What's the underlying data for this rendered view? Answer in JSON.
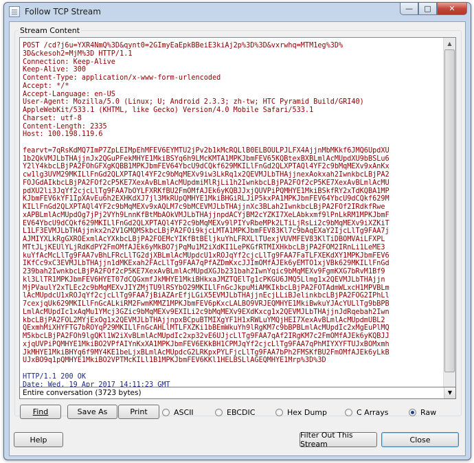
{
  "window": {
    "title": "Follow TCP Stream",
    "caption_buttons": [
      "minimize-icon",
      "maximize-icon",
      "close-icon"
    ]
  },
  "group": {
    "label": "Stream Content"
  },
  "stream": {
    "request_lines": [
      "POST /cd?j6u=YXR4NmQ%3D&qynt0=2GImyEaEpkBBeiE3kiAj2p%3D%3D&vxrwhq=MTM1eg%3D%",
      "3D&ckesoh2=MjM%3D HTTP/1.1",
      "Connection: Keep-Alive",
      "Keep-Alive: 300",
      "Content-Type: application/x-www-form-urlencoded",
      "Accept: */*",
      "Accept-Language: en-US",
      "User-Agent: Mozilla/5.0 (Linux; U; Android 2.3.3; zh-tw; HTC Pyramid Build/GRI40)",
      "AppleWebKit/533.1 (KHTML, like Gecko) Version/4.0 Mobile Safari/533.1",
      "Charset: utf-8",
      "Content-Length: 2335",
      "Host: 100.198.119.6"
    ],
    "body_lines": [
      "fearvt=7qRsKdMQ7ImP7ZpLEIMpEhMFEV6EYMTU2jPv2b1kMcRQLlB0ELBOULPJLFX4AjjnMbMKkf6JMQ6UpdXU",
      "1b2QkVMJLbTHAjjnJx2QGuPFekMHYE1MkiBSYq6h9LMcKMTA1MPKJbmFEV65KQBtexBXBLmlAcMUpdXU9bBSLu6",
      "Y2lY4kbcLBjPA2FOhGFXgKQBB1MPKJbmFEV64YbcU9dCQkf629MKILlFnGd2QLXPTAQl4YF2c9bMqMEXv9xAnKx",
      "cw1lg3UVM29MKILlFnGd2QLXPTAQl4YF2c9bMqMEXv9iw3LkRq1x2QEVMJLbTHAjjnexAokxah2IwnkbcLBjPA2",
      "FOJGdAIkbcLBjPA2FOf2cP5KE7XexAvBLmlAcMUpdmiMlRjLi1h2IwnkbcLBjPA2FOf2cP5KE7XexAvBLmlAcMU",
      "pdXU2li3JqYf2cjcLlTg9FAA7bOYLFXRKfBU2FmOMfAJEk6yKQBJJxjQUVPiPQMHYE1MkiBSkfRY2xTdKQBA1MP",
      "KJbmFEV6kYF1IpXAvEu6h2EXHKdXJ7jl3MkRUpQMHYE1MkiBHGiRLJiP5kxPA1MPKJbmFEV64YbcU9dCQkf629M",
      "KILlFnGd2QLXPTAQl4YF2c9bMqMEXv9xAQLM7c9bMCEVMJLbTHAjjnXc3BLah2IwnkbcLBjPA2FOf2IRdkfRwe",
      "xAPBLmlAcMUpdOg7jPj2VYh9LnnKfBtMbAOkVMJLbTHAjjnpdACYjBM2cYZKI7XeLAbkxmf9lPnLkRM1MPKJbmF",
      "EV64YbcU9dCQkf629MKILlFnGd2QLXPTAQl4YF2c9bMqMEXv9lPIYvRbeMPk2LTiLjRsLi2c9bMqMEXv9iXZKiT",
      "L1LF3EVMJLbTHAjjnkx2n2V1GMQMSkbcLBjPA2FOi9kjcLMTA1MPKJbmFEV83Kl7c9bAqEXaY2IjcLlTg9FAA7j",
      "AJMIYXLkRgGXROExmlAcYXkbcLBjPA2FOEMcYIKfBtBEljkuYhLFRXLlTUexjVUVMFEV83KlTiDBOMVAiLFXPL",
      "MTtJLjKEUlYLjRdKdPY2FmOMfAJEk6yMkBO7jPqMu1M2iXdKI1LePKGfRTMIXHkbcLBjPA2FOM2IRnLi1LeME3",
      "kuYfAcMcLlTg9FAA7vBhLFRcLlTG2djXBLmlAcMUpdcU1xROJqYf2cjcLlTg9FAA7FaTLFXEKdXY1MPKJbmFEV6",
      "IKfCc9xC3EVMJLbTHAjjn1dMKExah2FAcLlTg9FAA7qPfAZDmKxcJJImOMfAJEk6yEMTO1xjVBk629MKILlFnGd",
      "239bah2IwnkbcLBjPA2FOf2cP5KE7XexAvBLmlAcMUpdXGJb231bah2IwnYqic9bMqMEXv9FgmKXG7bRvM1Bf9",
      "kl3LlTR1MPKJbmFEV6HYET07dCQGxmfJkMHYE1MkiBHkxaJMZTQElTg1cPKGU6JMQ5Llmg1x2QEVMJLbTHAjjn",
      "MjPVaulY2xTLEc2c9bMqMEXvJIYZMjTU9lRSYbO29MKILlFnGcJkpuMiAMKIkbcLBjPA2FOTAdmWLxcH1MPVBLm",
      "lAcMUpdcU1xROJqYf2cjcLlTg9FAA7jBiAZArEfjLGiX5EVMJLbTHAjjnEcjLLiBJelinkbcLBjPA2FOG2IPhLl",
      "7cexjqUk629MKILlFnGcALkiRM2FwmKMMZ1MPKJbmFEV6pKxcLALBO9VRJEQMHYE1MkiBwkuYJAcYULlTg9bBPB",
      "LmlAcMUpdIc1xAqMu1YMcj3GZic9bMqMEXv9EXILi2c9bMqMEXv9EXdKxcg1x2QEVMJLbTHAjjnJdRqebah2Iwn",
      "kbcLBjPA2FOL2MYjExOg1x2QEVMJLbTHAjjnpxBCpuBTMIXgYF1H1xRWLuYMQjHEI7XexAvBLmlAcMUpdmUBL2",
      "QExmhMiXHYFTG7bROYqP29MKILlFnGcAHLlMTLFXZKi1bBEmWkuYh9lRgKM7c9bBPBLmlAcMUpdIc2xMgEuPlMQ",
      "M5kbcLBjPA2FOh9lgQKl1W2iXvBLmlAcMUpdIc2xp32vE6UJjcLlTg9FAA7qAf2IRgKM7c2FmOMfAJEk6yKQBJJ",
      "xjqUVPiPQMHYE1MkiBO2VPfAIYnKxXA1MPKJbmFEV6EKkBH1CPMJqYf2cjcLlTg9FAA7qPhMIYXYFTUJxBOMxmh",
      "JkMHYE1MkiBHYq6f9MY4KE1beLjxBLmlAcMUpdcG2LRKpxPYLFjcLlTg9FAA7bPh2FMSKfBU2FmOMfAJEk6yLkB",
      "UJxBO9q1pQMHYE1MkiBO2VPTMcKILl1B1MPKJbmFEV6KKl1HELBSLlAGEQMHYE1Mrp%3D%3D"
    ],
    "response_lines": [
      "HTTP/1.1 200 OK",
      "Date: Wed, 19 Apr 2017 14:11:23 GMT"
    ]
  },
  "conversation_select": {
    "value": "Entire conversation (3723 bytes)"
  },
  "actions": {
    "find": "Find",
    "save_as": "Save As",
    "print": "Print"
  },
  "encoding": {
    "options": [
      "ASCII",
      "EBCDIC",
      "Hex Dump",
      "C Arrays",
      "Raw"
    ],
    "selected": "Raw"
  },
  "footer": {
    "help": "Help",
    "filter": "Filter Out This Stream",
    "close": "Close"
  }
}
